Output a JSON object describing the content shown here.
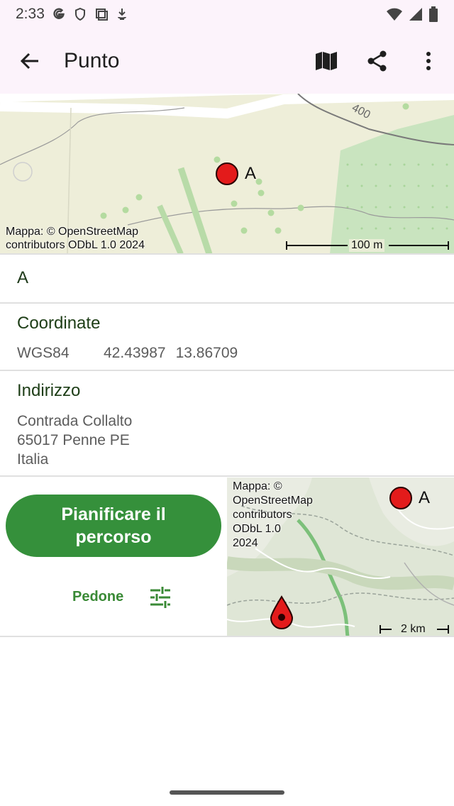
{
  "status_bar": {
    "time": "2:33"
  },
  "app_bar": {
    "title": "Punto"
  },
  "map_top": {
    "attribution": [
      "Mappa: © OpenStreetMap",
      "contributors ODbL 1.0 2024"
    ],
    "scale": "100 m",
    "marker_label": "A",
    "contour_label": "400"
  },
  "point": {
    "name": "A"
  },
  "coordinates": {
    "title": "Coordinate",
    "system": "WGS84",
    "lat": "42.43987",
    "lon": "13.86709"
  },
  "address": {
    "title": "Indirizzo",
    "lines": [
      "Contrada Collalto",
      "65017 Penne PE",
      "Italia"
    ]
  },
  "route": {
    "button_label": "Pianificare il percorso",
    "mode": "Pedone"
  },
  "map_small": {
    "attribution": [
      "Mappa: ©",
      "OpenStreetMap",
      "contributors",
      "ODbL 1.0",
      "2024"
    ],
    "scale": "2 km",
    "marker_label": "A"
  },
  "colors": {
    "accent": "#35903b",
    "marker": "#e31b1b",
    "app_bar_bg": "#fcf3fb"
  }
}
